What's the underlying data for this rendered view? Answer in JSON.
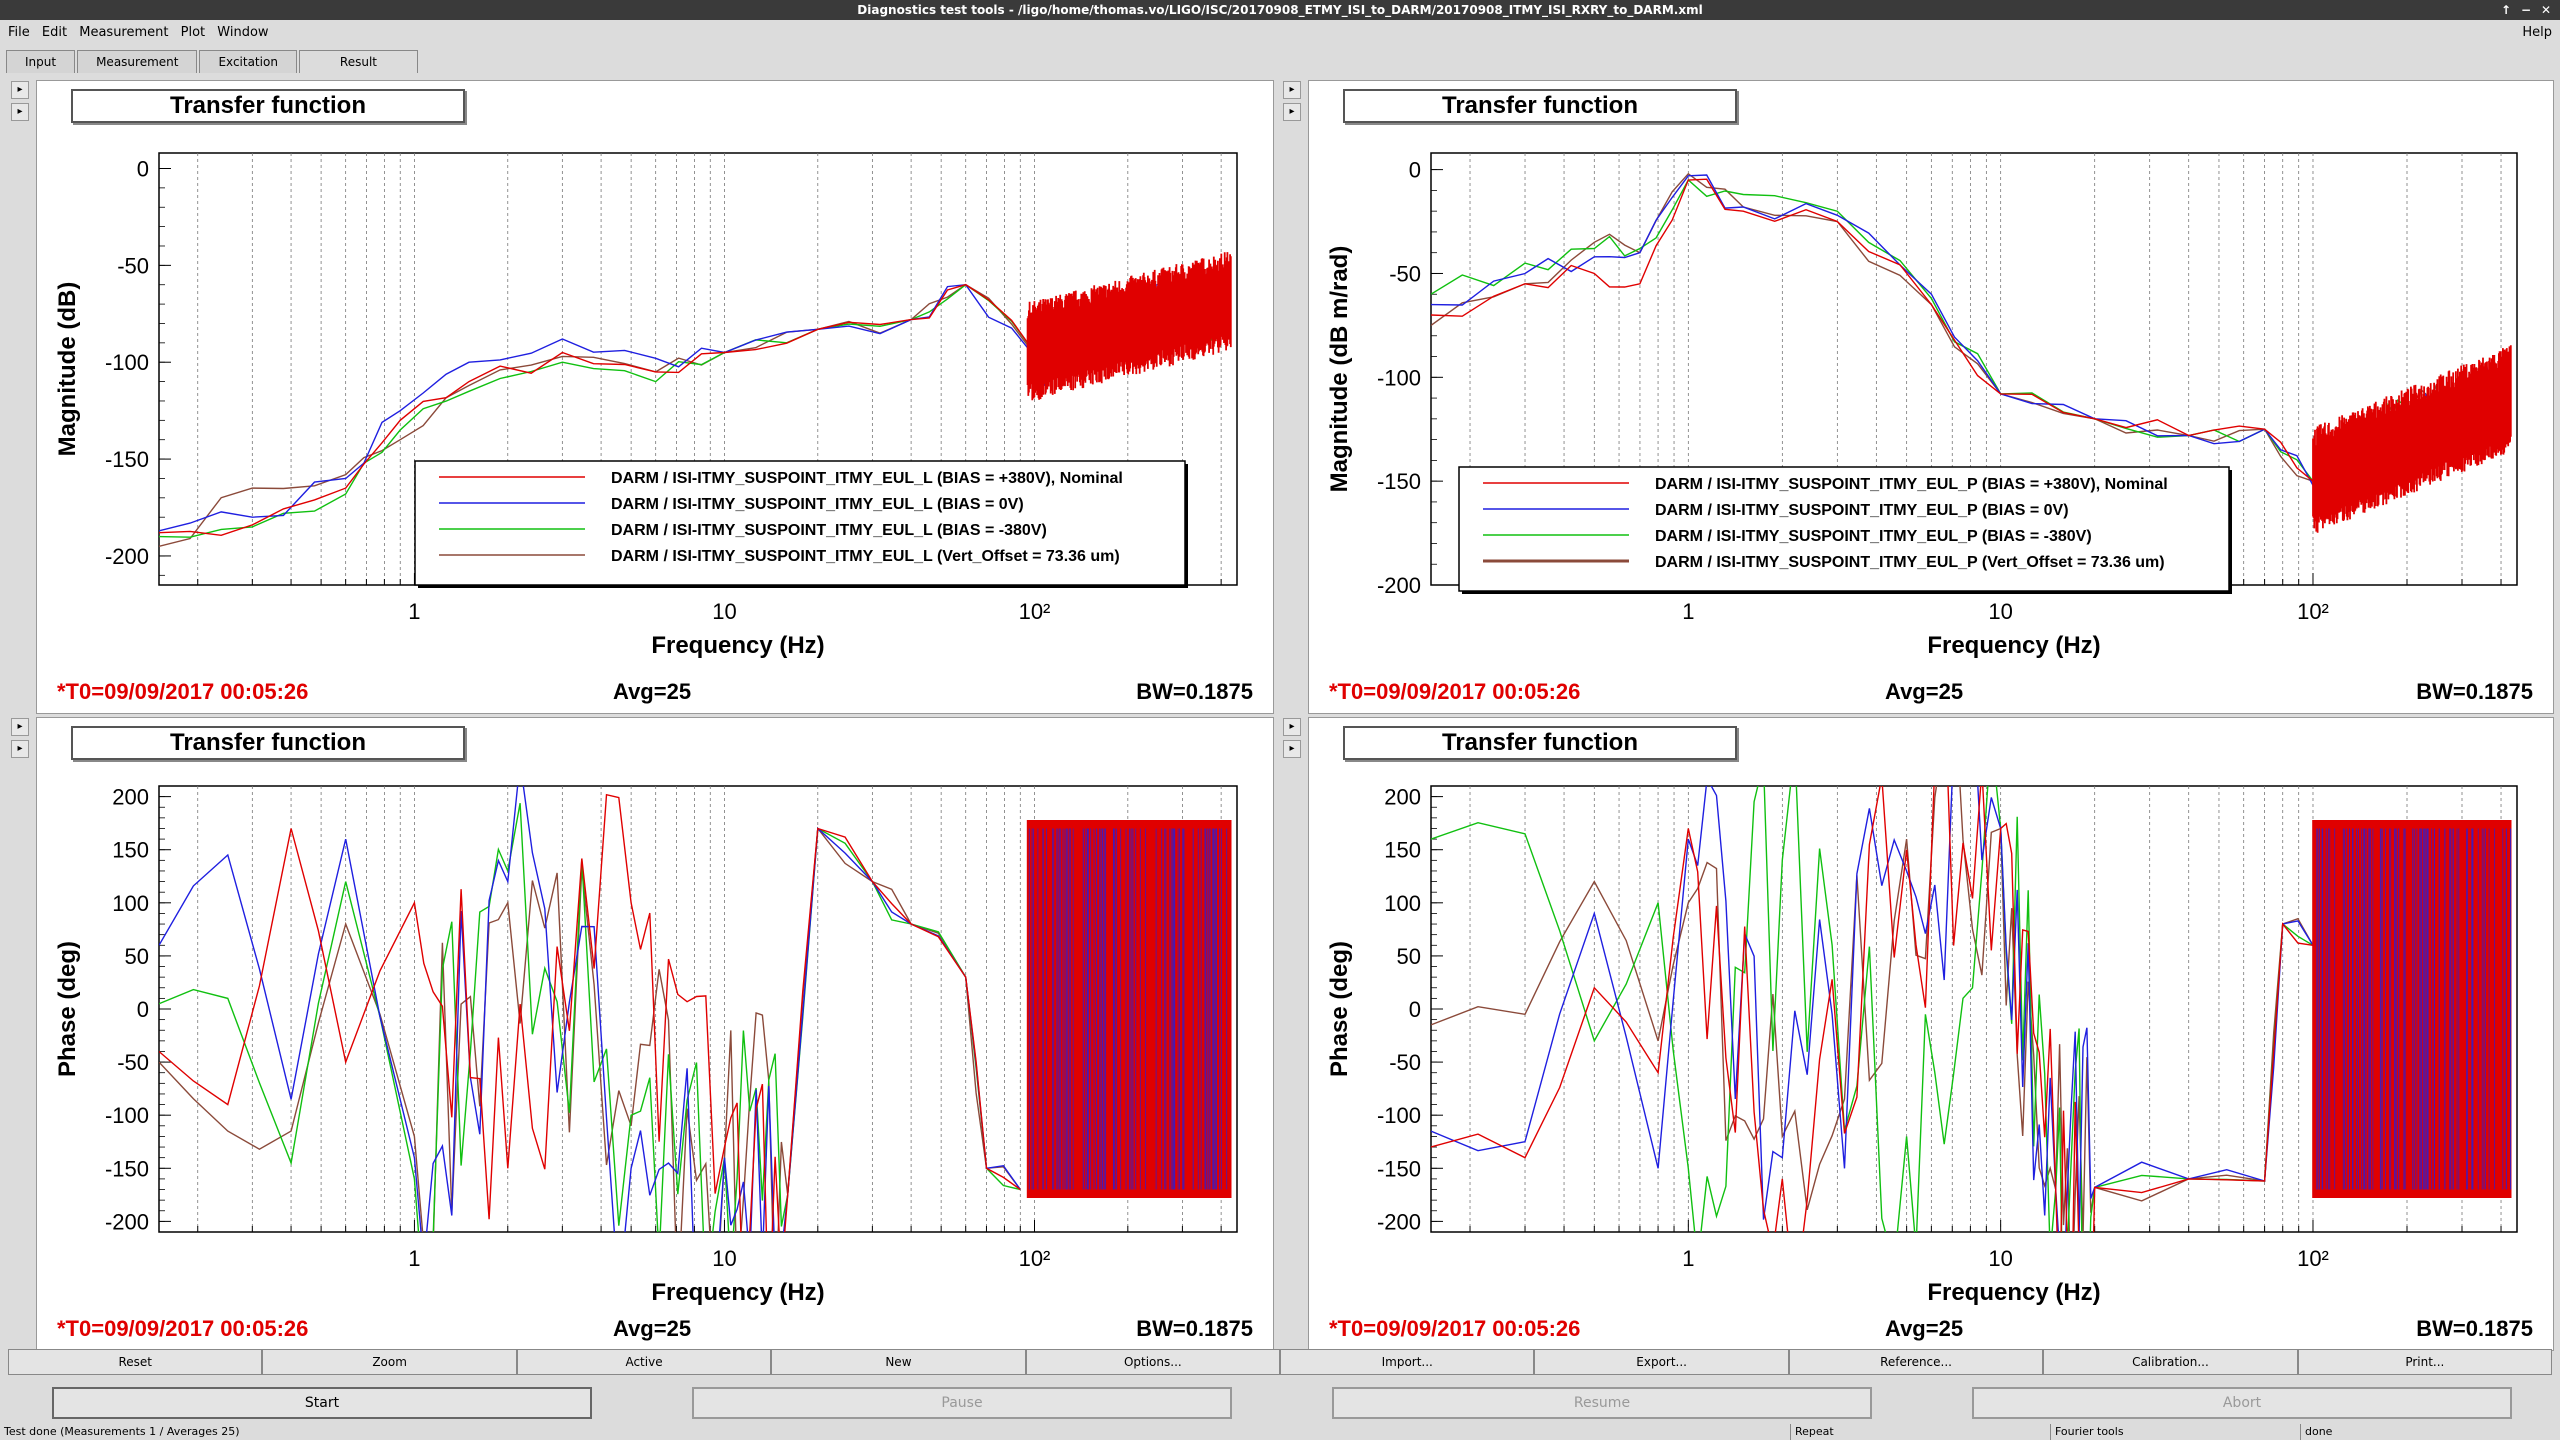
{
  "window": {
    "title": "Diagnostics test tools - /ligo/home/thomas.vo/LIGO/ISC/20170908_ETMY_ISI_to_DARM/20170908_ITMY_ISI_RXRY_to_DARM.xml",
    "btn1": "↑",
    "btn2": "−",
    "btn3": "✕"
  },
  "menu": {
    "file": "File",
    "edit": "Edit",
    "measurement": "Measurement",
    "plot": "Plot",
    "window": "Window",
    "help": "Help"
  },
  "tabs": [
    "Input",
    "Measurement",
    "Excitation",
    "Result"
  ],
  "panels": [
    {
      "title": "Transfer function",
      "ylabel": "Magnitude (dB)",
      "xlabel": "Frequency (Hz)",
      "yticks": [
        "0",
        "-50",
        "-100",
        "-150",
        "-200"
      ],
      "xticks": [
        "1",
        "10",
        "10²"
      ],
      "legend": [
        "DARM / ISI-ITMY_SUSPOINT_ITMY_EUL_L (BIAS = +380V), Nominal",
        "DARM / ISI-ITMY_SUSPOINT_ITMY_EUL_L (BIAS = 0V)",
        "DARM / ISI-ITMY_SUSPOINT_ITMY_EUL_L (BIAS = -380V)",
        "DARM / ISI-ITMY_SUSPOINT_ITMY_EUL_L (Vert_Offset = 73.36 um)"
      ],
      "t0": "*T0=09/09/2017 00:05:26",
      "avg": "Avg=25",
      "bw": "BW=0.1875"
    },
    {
      "title": "Transfer function",
      "ylabel": "Magnitude (dB m/rad)",
      "xlabel": "Frequency (Hz)",
      "yticks": [
        "0",
        "-50",
        "-100",
        "-150",
        "-200"
      ],
      "xticks": [
        "1",
        "10",
        "10²"
      ],
      "legend": [
        "DARM / ISI-ITMY_SUSPOINT_ITMY_EUL_P (BIAS = +380V), Nominal",
        "DARM / ISI-ITMY_SUSPOINT_ITMY_EUL_P (BIAS = 0V)",
        "DARM / ISI-ITMY_SUSPOINT_ITMY_EUL_P (BIAS = -380V)",
        "DARM / ISI-ITMY_SUSPOINT_ITMY_EUL_P (Vert_Offset = 73.36 um)"
      ],
      "t0": "*T0=09/09/2017 00:05:26",
      "avg": "Avg=25",
      "bw": "BW=0.1875"
    },
    {
      "title": "Transfer function",
      "ylabel": "Phase (deg)",
      "xlabel": "Frequency (Hz)",
      "yticks": [
        "200",
        "150",
        "100",
        "50",
        "0",
        "-50",
        "-100",
        "-150",
        "-200"
      ],
      "xticks": [
        "1",
        "10",
        "10²"
      ],
      "legend": [],
      "t0": "*T0=09/09/2017 00:05:26",
      "avg": "Avg=25",
      "bw": "BW=0.1875"
    },
    {
      "title": "Transfer function",
      "ylabel": "Phase (deg)",
      "xlabel": "Frequency (Hz)",
      "yticks": [
        "200",
        "150",
        "100",
        "50",
        "0",
        "-50",
        "-100",
        "-150",
        "-200"
      ],
      "xticks": [
        "1",
        "10",
        "10²"
      ],
      "legend": [],
      "t0": "*T0=09/09/2017 00:05:26",
      "avg": "Avg=25",
      "bw": "BW=0.1875"
    }
  ],
  "series_colors": [
    "#e00000",
    "#1f1fe0",
    "#10c010",
    "#8b4a3a"
  ],
  "toolbar": [
    "Reset",
    "Zoom",
    "Active",
    "New",
    "Options...",
    "Import...",
    "Export...",
    "Reference...",
    "Calibration...",
    "Print..."
  ],
  "actions": {
    "start": "Start",
    "pause": "Pause",
    "resume": "Resume",
    "abort": "Abort"
  },
  "status": {
    "main": "Test done (Measurements 1 / Averages 25)",
    "repeat": "Repeat",
    "tool": "Fourier tools",
    "state": "done"
  },
  "chart_data": [
    {
      "type": "line",
      "title": "Transfer function",
      "xlabel": "Frequency (Hz)",
      "ylabel": "Magnitude (dB)",
      "xscale": "log",
      "xlim": [
        0.15,
        450
      ],
      "ylim": [
        -215,
        8
      ],
      "grid": true,
      "legend_position": "bottom-right",
      "series": [
        {
          "name": "DARM / ISI-ITMY_SUSPOINT_ITMY_EUL_L (BIAS = +380V), Nominal",
          "x": [
            0.15,
            0.3,
            0.6,
            0.9,
            1.5,
            3,
            6,
            10,
            20,
            40,
            60,
            100,
            200,
            400
          ],
          "y": [
            -188,
            -184,
            -165,
            -130,
            -110,
            -95,
            -105,
            -95,
            -83,
            -78,
            -60,
            -95,
            -80,
            -68
          ]
        },
        {
          "name": "DARM / ISI-ITMY_SUSPOINT_ITMY_EUL_L (BIAS = 0V)",
          "x": [
            0.15,
            0.3,
            0.6,
            0.9,
            1.5,
            3,
            6,
            10,
            20,
            40,
            60,
            100,
            200,
            400
          ],
          "y": [
            -187,
            -180,
            -160,
            -125,
            -100,
            -88,
            -98,
            -95,
            -83,
            -78,
            -60,
            -97,
            -82,
            -68
          ]
        },
        {
          "name": "DARM / ISI-ITMY_SUSPOINT_ITMY_EUL_L (BIAS = -380V)",
          "x": [
            0.15,
            0.3,
            0.6,
            0.9,
            1.5,
            3,
            6,
            10,
            20,
            40,
            60,
            100,
            200,
            400
          ],
          "y": [
            -190,
            -185,
            -168,
            -135,
            -115,
            -100,
            -110,
            -95,
            -83,
            -78,
            -60,
            -95,
            -80,
            -70
          ]
        },
        {
          "name": "DARM / ISI-ITMY_SUSPOINT_ITMY_EUL_L (Vert_Offset = 73.36 um)",
          "x": [
            0.15,
            0.3,
            0.6,
            0.9,
            1.5,
            3,
            6,
            10,
            20,
            40,
            60,
            100,
            200,
            400
          ],
          "y": [
            -195,
            -165,
            -158,
            -140,
            -112,
            -97,
            -105,
            -95,
            -83,
            -78,
            -60,
            -96,
            -81,
            -69
          ]
        }
      ]
    },
    {
      "type": "line",
      "title": "Transfer function",
      "xlabel": "Frequency (Hz)",
      "ylabel": "Magnitude (dB m/rad)",
      "xscale": "log",
      "xlim": [
        0.15,
        450
      ],
      "ylim": [
        -200,
        8
      ],
      "grid": true,
      "legend_position": "bottom-left",
      "series": [
        {
          "name": "DARM / ISI-ITMY_SUSPOINT_ITMY_EUL_P (BIAS = +380V), Nominal",
          "x": [
            0.15,
            0.3,
            0.5,
            0.7,
            1.0,
            1.5,
            3,
            6,
            10,
            20,
            40,
            70,
            100,
            200,
            400
          ],
          "y": [
            -70,
            -55,
            -50,
            -55,
            -5,
            -20,
            -25,
            -65,
            -108,
            -120,
            -128,
            -125,
            -150,
            -125,
            -110
          ]
        },
        {
          "name": "DARM / ISI-ITMY_SUSPOINT_ITMY_EUL_P (BIAS = 0V)",
          "x": [
            0.15,
            0.3,
            0.5,
            0.7,
            1.0,
            1.5,
            3,
            6,
            10,
            20,
            40,
            70,
            100,
            200,
            400
          ],
          "y": [
            -65,
            -50,
            -42,
            -40,
            -3,
            -18,
            -22,
            -60,
            -108,
            -120,
            -128,
            -125,
            -152,
            -125,
            -110
          ]
        },
        {
          "name": "DARM / ISI-ITMY_SUSPOINT_ITMY_EUL_P (BIAS = -380V)",
          "x": [
            0.15,
            0.3,
            0.5,
            0.7,
            1.0,
            1.5,
            3,
            6,
            10,
            20,
            40,
            70,
            100,
            200,
            400
          ],
          "y": [
            -60,
            -45,
            -38,
            -38,
            -5,
            -12,
            -20,
            -62,
            -108,
            -120,
            -128,
            -125,
            -150,
            -125,
            -110
          ]
        },
        {
          "name": "DARM / ISI-ITMY_SUSPOINT_ITMY_EUL_P (Vert_Offset = 73.36 um)",
          "x": [
            0.15,
            0.3,
            0.5,
            0.7,
            1.0,
            1.5,
            3,
            6,
            10,
            20,
            40,
            70,
            100,
            200,
            400
          ],
          "y": [
            -75,
            -55,
            -35,
            -40,
            -2,
            -18,
            -25,
            -65,
            -108,
            -120,
            -128,
            -125,
            -150,
            -125,
            -110
          ]
        }
      ]
    },
    {
      "type": "line",
      "title": "Transfer function",
      "xlabel": "Frequency (Hz)",
      "ylabel": "Phase (deg)",
      "xscale": "log",
      "xlim": [
        0.15,
        450
      ],
      "ylim": [
        -210,
        210
      ],
      "grid": true,
      "series": [
        {
          "name": "DARM / ISI-ITMY_SUSPOINT_ITMY_EUL_L (BIAS = +380V), Nominal",
          "x": [
            0.15,
            0.25,
            0.4,
            0.6,
            1,
            2,
            5,
            10,
            16,
            20,
            30,
            40,
            60,
            70,
            90
          ],
          "y": [
            -40,
            -90,
            170,
            -50,
            100,
            -150,
            100,
            -130,
            -175,
            170,
            120,
            80,
            30,
            -150,
            -170
          ]
        },
        {
          "name": "DARM / ISI-ITMY_SUSPOINT_ITMY_EUL_L (BIAS = 0V)",
          "x": [
            0.15,
            0.25,
            0.4,
            0.6,
            1,
            2,
            5,
            10,
            16,
            20,
            30,
            40,
            60,
            70,
            90
          ],
          "y": [
            60,
            145,
            -85,
            160,
            -140,
            120,
            -150,
            -140,
            -175,
            170,
            120,
            80,
            30,
            -150,
            -170
          ]
        },
        {
          "name": "DARM / ISI-ITMY_SUSPOINT_ITMY_EUL_L (BIAS = -380V)",
          "x": [
            0.15,
            0.25,
            0.4,
            0.6,
            1,
            2,
            5,
            10,
            16,
            20,
            30,
            40,
            60,
            70,
            90
          ],
          "y": [
            5,
            10,
            -145,
            120,
            -160,
            130,
            -100,
            -140,
            -175,
            170,
            120,
            80,
            30,
            -150,
            -170
          ]
        },
        {
          "name": "DARM / ISI-ITMY_SUSPOINT_ITMY_EUL_L (Vert_Offset = 73.36 um)",
          "x": [
            0.15,
            0.25,
            0.4,
            0.6,
            1,
            2,
            5,
            10,
            16,
            20,
            30,
            40,
            60,
            70,
            90
          ],
          "y": [
            -50,
            -115,
            -115,
            80,
            -120,
            100,
            -110,
            -140,
            -175,
            170,
            120,
            80,
            30,
            -150,
            -170
          ]
        }
      ]
    },
    {
      "type": "line",
      "title": "Transfer function",
      "xlabel": "Frequency (Hz)",
      "ylabel": "Phase (deg)",
      "xscale": "log",
      "xlim": [
        0.15,
        450
      ],
      "ylim": [
        -210,
        210
      ],
      "grid": true,
      "series": [
        {
          "name": "DARM / ISI-ITMY_SUSPOINT_ITMY_EUL_P (BIAS = +380V), Nominal",
          "x": [
            0.15,
            0.3,
            0.5,
            0.8,
            1,
            2,
            5,
            10,
            15,
            20,
            40,
            70,
            80,
            100
          ],
          "y": [
            -130,
            -140,
            20,
            -60,
            170,
            -160,
            150,
            170,
            -170,
            -168,
            -160,
            -162,
            80,
            60
          ]
        },
        {
          "name": "DARM / ISI-ITMY_SUSPOINT_ITMY_EUL_P (BIAS = 0V)",
          "x": [
            0.15,
            0.3,
            0.5,
            0.8,
            1,
            2,
            5,
            10,
            15,
            20,
            40,
            70,
            80,
            100
          ],
          "y": [
            -115,
            -125,
            90,
            -150,
            160,
            -140,
            130,
            170,
            -170,
            -168,
            -160,
            -162,
            80,
            60
          ]
        },
        {
          "name": "DARM / ISI-ITMY_SUSPOINT_ITMY_EUL_P (BIAS = -380V)",
          "x": [
            0.15,
            0.3,
            0.5,
            0.8,
            1,
            2,
            5,
            10,
            15,
            20,
            40,
            70,
            80,
            100
          ],
          "y": [
            160,
            165,
            -30,
            100,
            -150,
            140,
            -120,
            170,
            -170,
            -168,
            -160,
            -162,
            80,
            60
          ]
        },
        {
          "name": "DARM / ISI-ITMY_SUSPOINT_ITMY_EUL_P (Vert_Offset = 73.36 um)",
          "x": [
            0.15,
            0.3,
            0.5,
            0.8,
            1,
            2,
            5,
            10,
            15,
            20,
            40,
            70,
            80,
            100
          ],
          "y": [
            -15,
            -5,
            120,
            -30,
            100,
            -120,
            160,
            170,
            -170,
            -168,
            -160,
            -162,
            80,
            60
          ]
        }
      ]
    }
  ]
}
